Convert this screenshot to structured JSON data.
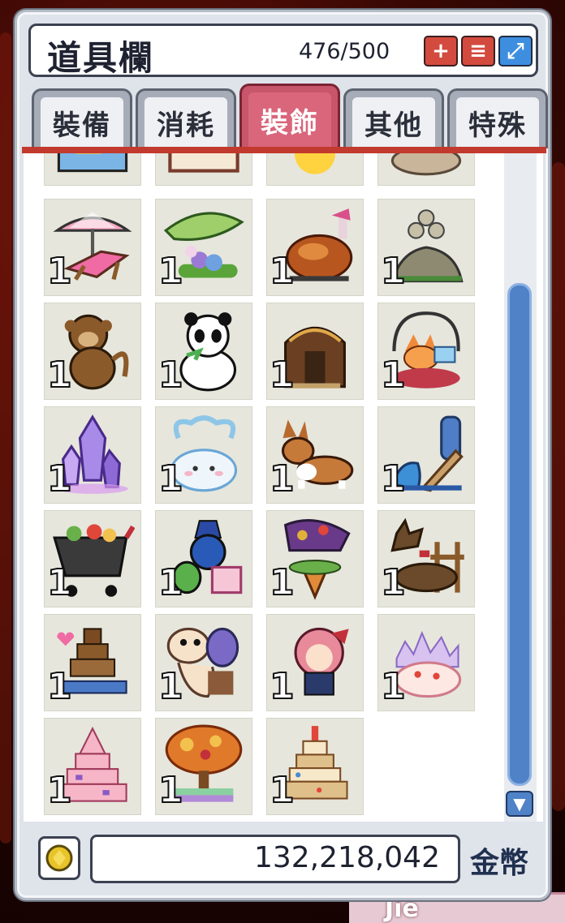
{
  "window": {
    "title": "道具欄",
    "capacity": "476/500",
    "buttons": {
      "add": "+",
      "menu": "≡",
      "expand": "⤢"
    }
  },
  "tabs": [
    {
      "label": "裝備",
      "active": false
    },
    {
      "label": "消耗",
      "active": false
    },
    {
      "label": "裝飾",
      "active": true
    },
    {
      "label": "其他",
      "active": false
    },
    {
      "label": "特殊",
      "active": false
    }
  ],
  "items": [
    {
      "name": "partial-item-1",
      "qty": ""
    },
    {
      "name": "partial-item-2",
      "qty": ""
    },
    {
      "name": "partial-item-3",
      "qty": ""
    },
    {
      "name": "partial-item-4",
      "qty": ""
    },
    {
      "name": "beach-chair",
      "qty": "1"
    },
    {
      "name": "leaf-umbrella-flowers",
      "qty": "1"
    },
    {
      "name": "roast-turkey",
      "qty": "1"
    },
    {
      "name": "stone-pile",
      "qty": "1"
    },
    {
      "name": "monkey",
      "qty": "1"
    },
    {
      "name": "panda",
      "qty": "1"
    },
    {
      "name": "wooden-shrine",
      "qty": "1"
    },
    {
      "name": "fox-basket",
      "qty": "1"
    },
    {
      "name": "crystal-cluster",
      "qty": "1"
    },
    {
      "name": "cloud-creature",
      "qty": "1"
    },
    {
      "name": "corgi",
      "qty": "1"
    },
    {
      "name": "dolphin-slide",
      "qty": "1"
    },
    {
      "name": "shopping-cart",
      "qty": "1"
    },
    {
      "name": "penguin-cake",
      "qty": "1"
    },
    {
      "name": "horse-top",
      "qty": "1"
    },
    {
      "name": "donkey-fence",
      "qty": "1"
    },
    {
      "name": "chocolate-fountain",
      "qty": "1"
    },
    {
      "name": "snake-puppet",
      "qty": "1"
    },
    {
      "name": "girl-doll",
      "qty": "1"
    },
    {
      "name": "crystal-cake",
      "qty": "1"
    },
    {
      "name": "pink-tiered-cake",
      "qty": "1"
    },
    {
      "name": "autumn-tree",
      "qty": "1"
    },
    {
      "name": "birthday-cake",
      "qty": "1"
    }
  ],
  "footer": {
    "meso_amount": "132,218,042",
    "meso_label": "金幣"
  },
  "nameplate": "Jie",
  "colors": {
    "active_tab": "#d9667b",
    "tab_line": "#c23a2e",
    "scroll": "#4f82c6"
  }
}
